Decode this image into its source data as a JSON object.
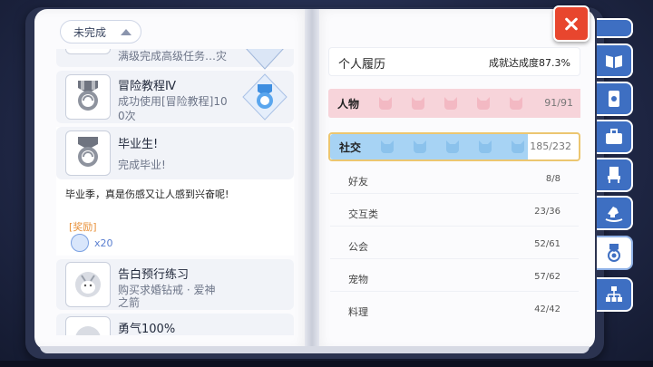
{
  "filter": {
    "label": "未完成"
  },
  "achievements": [
    {
      "title": "",
      "desc": "满级完成高级任务…灾"
    },
    {
      "title": "冒险教程Ⅳ",
      "desc_line1": "成功使用[冒险教程]10",
      "desc_line2": "0次"
    },
    {
      "title": "毕业生!",
      "desc": "完成毕业!",
      "quote": "毕业季，真是伤感又让人感到兴奋呢!",
      "reward_label": "[奖励]",
      "reward_count": "x20"
    },
    {
      "title": "告白预行练习",
      "desc_line1": "购买求婚钻戒 · 爱神",
      "desc_line2": "之箭"
    },
    {
      "title": "勇气100%"
    }
  ],
  "resume": {
    "title": "个人履历",
    "rate": "成就达成度87.3%"
  },
  "categories": [
    {
      "label": "人物",
      "count": "91/91",
      "progress": 1.0,
      "color": "#f7d4da"
    },
    {
      "label": "社交",
      "count": "185/232",
      "progress": 0.797,
      "color": "#a7d3f4"
    }
  ],
  "social_subs": [
    {
      "label": "好友",
      "count": "8/8"
    },
    {
      "label": "交互类",
      "count": "23/36"
    },
    {
      "label": "公会",
      "count": "52/61"
    },
    {
      "label": "宠物",
      "count": "57/62"
    },
    {
      "label": "料理",
      "count": "42/42"
    }
  ],
  "tabs": [
    {
      "icon": "book-icon"
    },
    {
      "icon": "card-icon"
    },
    {
      "icon": "toolbox-icon"
    },
    {
      "icon": "throne-icon"
    },
    {
      "icon": "rocking-horse-icon"
    },
    {
      "icon": "medal-icon",
      "active": true
    },
    {
      "icon": "org-chart-icon"
    }
  ],
  "colors": {
    "accent_blue": "#3e6fc2",
    "close_red": "#e8462e",
    "gold": "#ecc670"
  }
}
